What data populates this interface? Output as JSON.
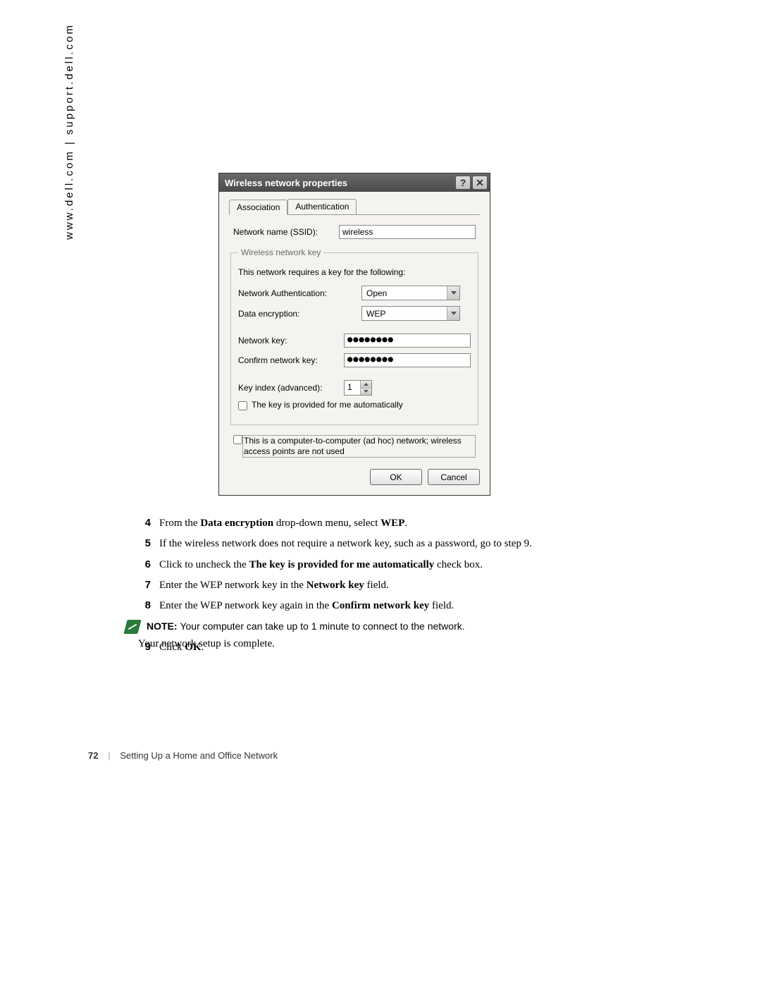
{
  "sidebar": {
    "text": "www.dell.com | support.dell.com"
  },
  "dialog": {
    "title": "Wireless network properties",
    "helpGlyph": "?",
    "closeGlyph": "✕",
    "tabs": {
      "association": "Association",
      "authentication": "Authentication"
    },
    "ssidLabel": "Network name (SSID):",
    "ssidValue": "wireless",
    "fieldsetLegend": "Wireless network key",
    "hint": "This network requires a key for the following:",
    "authLabel": "Network Authentication:",
    "authValue": "Open",
    "encLabel": "Data encryption:",
    "encValue": "WEP",
    "keyLabel": "Network key:",
    "keyValue": "●●●●●●●●",
    "confirmLabel": "Confirm network key:",
    "confirmValue": "●●●●●●●●",
    "indexLabel": "Key index (advanced):",
    "indexValue": "1",
    "autokeyLabel": "The key is provided for me automatically",
    "adhocLabel": "This is a computer-to-computer (ad hoc) network; wireless access points are not used",
    "ok": "OK",
    "cancel": "Cancel"
  },
  "steps": {
    "s4": {
      "num": "4",
      "pre": "From the ",
      "b1": "Data encryption",
      "mid": " drop-down menu, select ",
      "b2": "WEP",
      "end": "."
    },
    "s5": {
      "num": "5",
      "txt": "If the wireless network does not require a network key, such as a password, go to step 9."
    },
    "s6": {
      "num": "6",
      "pre": "Click to uncheck the ",
      "b1": "The key is provided for me automatically",
      "end": " check box."
    },
    "s7": {
      "num": "7",
      "pre": "Enter the WEP network key in the ",
      "b1": "Network key",
      "end": " field."
    },
    "s8": {
      "num": "8",
      "pre": "Enter the WEP network key again in the ",
      "b1": "Confirm network key",
      "end": " field."
    },
    "note": {
      "label": "NOTE: ",
      "txt": "Your computer can take up to 1 minute to connect to the network."
    },
    "s9": {
      "num": "9",
      "pre": "Click ",
      "b1": "OK",
      "end": "."
    }
  },
  "closing": "Your network setup is complete.",
  "footer": {
    "page": "72",
    "section": "Setting Up a Home and Office Network"
  }
}
